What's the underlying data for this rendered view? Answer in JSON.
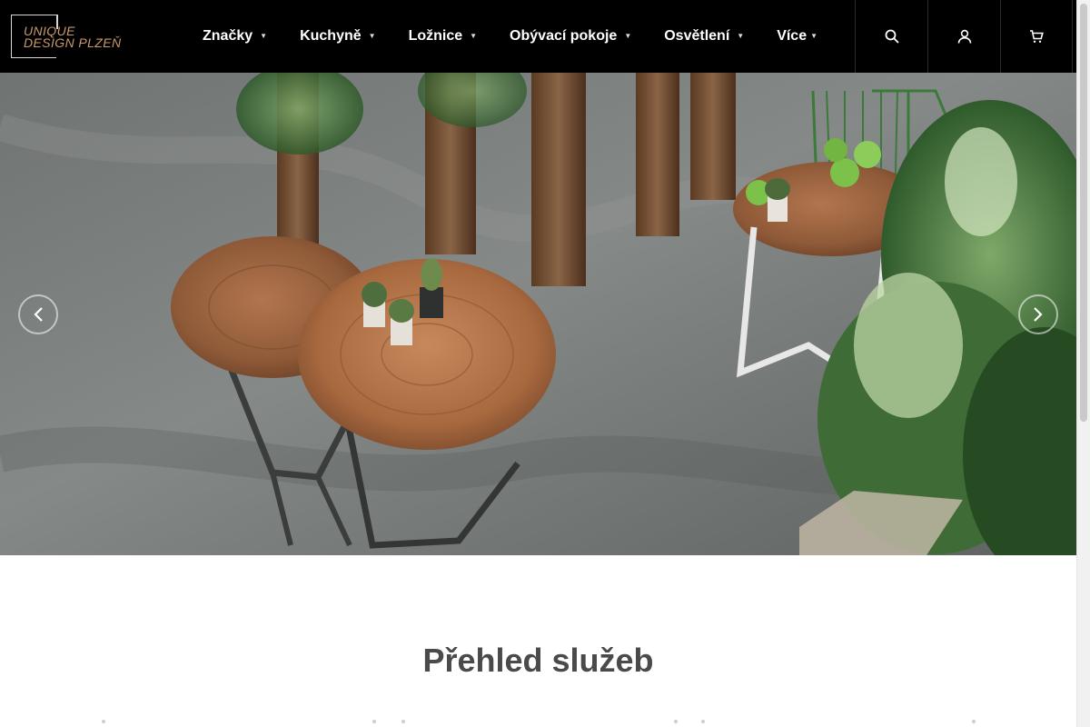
{
  "header": {
    "logo": {
      "line1": "UNIQUE",
      "line2": "DESIGN PLZEŇ"
    },
    "nav": [
      {
        "label": "Značky",
        "has_dropdown": true
      },
      {
        "label": "Kuchyně",
        "has_dropdown": true
      },
      {
        "label": "Ložnice",
        "has_dropdown": true
      },
      {
        "label": "Obývací pokoje",
        "has_dropdown": true
      },
      {
        "label": "Osvětlení",
        "has_dropdown": true
      },
      {
        "label": "Více",
        "has_dropdown": true
      }
    ],
    "icons": [
      "search-icon",
      "user-icon",
      "cart-icon"
    ]
  },
  "hero": {
    "prev_icon": "chevron-left-icon",
    "next_icon": "chevron-right-icon"
  },
  "services": {
    "title": "Přehled služeb"
  },
  "colors": {
    "header_bg": "#000000",
    "logo_accent": "#c79a6a",
    "title_text": "#4a4a4a"
  }
}
